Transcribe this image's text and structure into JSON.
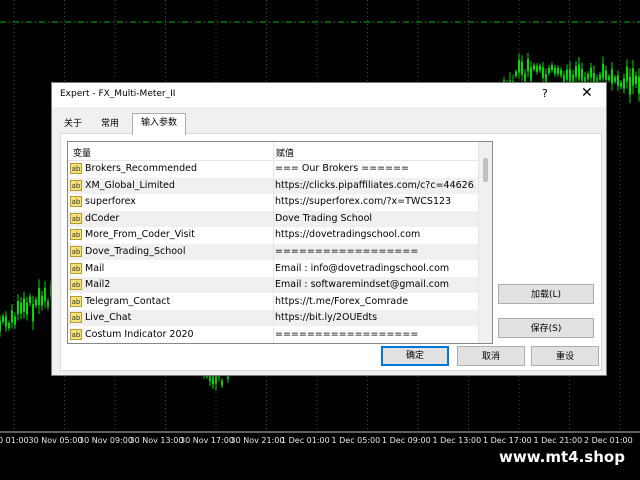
{
  "chart": {
    "time_axis": [
      "0 01:00",
      "30 Nov 05:00",
      "30 Nov 09:00",
      "30 Nov 13:00",
      "30 Nov 17:00",
      "30 Nov 21:00",
      "1 Dec 01:00",
      "1 Dec 05:00",
      "1 Dec 09:00",
      "1 Dec 13:00",
      "1 Dec 17:00",
      "1 Dec 21:00",
      "2 Dec 01:00"
    ],
    "candle_color": "#00e000",
    "watermark": "www.mt4.shop"
  },
  "dialog": {
    "title": "Expert - FX_Multi-Meter_II",
    "help": "?",
    "close": "✕",
    "tabs": [
      {
        "label": "关于"
      },
      {
        "label": "常用"
      },
      {
        "label": "输入参数"
      }
    ],
    "grid": {
      "col_variable": "变量",
      "col_value": "赋值",
      "rows": [
        {
          "icon": "ab",
          "name": "Brokers_Recommended",
          "value": "=== Our Brokers ======"
        },
        {
          "icon": "ab",
          "name": "XM_Global_Limited",
          "value": "https://clicks.pipaffiliates.com/c?c=44626..."
        },
        {
          "icon": "ab",
          "name": "superforex",
          "value": "https://superforex.com/?x=TWCS123"
        },
        {
          "icon": "ab",
          "name": "dCoder",
          "value": "Dove Trading School"
        },
        {
          "icon": "ab",
          "name": "More_From_Coder_Visit",
          "value": "https://dovetradingschool.com"
        },
        {
          "icon": "ab",
          "name": "Dove_Trading_School",
          "value": "=================="
        },
        {
          "icon": "ab",
          "name": "Mail",
          "value": "Email : info@dovetradingschool.com"
        },
        {
          "icon": "ab",
          "name": "Mail2",
          "value": "Email : softwaremindset@gmail.com"
        },
        {
          "icon": "ab",
          "name": "Telegram_Contact",
          "value": "https://t.me/Forex_Comrade"
        },
        {
          "icon": "ab",
          "name": "Live_Chat",
          "value": "https://bit.ly/2OUEdts"
        },
        {
          "icon": "ab",
          "name": "Costum Indicator 2020",
          "value": "=================="
        }
      ]
    },
    "buttons": {
      "load": "加载(L)",
      "save": "保存(S)",
      "ok": "确定",
      "cancel": "取消",
      "reset": "重设"
    }
  }
}
